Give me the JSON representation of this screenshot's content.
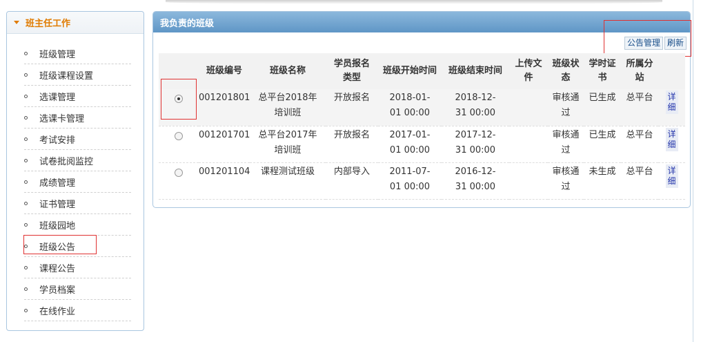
{
  "sidebar": {
    "title": "班主任工作",
    "items": [
      {
        "label": "班级管理"
      },
      {
        "label": "班级课程设置"
      },
      {
        "label": "选课管理"
      },
      {
        "label": "选课卡管理"
      },
      {
        "label": "考试安排"
      },
      {
        "label": "试卷批阅监控"
      },
      {
        "label": "成绩管理"
      },
      {
        "label": "证书管理"
      },
      {
        "label": "班级园地"
      },
      {
        "label": "班级公告"
      },
      {
        "label": "课程公告"
      },
      {
        "label": "学员档案"
      },
      {
        "label": "在线作业"
      }
    ]
  },
  "panel": {
    "title": "我负责的班级",
    "toolbar": {
      "announce_label": "公告管理",
      "refresh_label": "刷新"
    },
    "columns": [
      "班级编号",
      "班级名称",
      "学员报名类型",
      "班级开始时间",
      "班级结束时间",
      "上传文件",
      "班级状态",
      "学时证书",
      "所属分站"
    ],
    "rows": [
      {
        "selected": true,
        "code": "001201801",
        "name": "总平台2018年培训班",
        "type": "开放报名",
        "start": "2018-01-01 00:00",
        "end": "2018-12-31 00:00",
        "file": "",
        "status": "审核通过",
        "cert": "已生成",
        "station": "总平台",
        "detail": "详细"
      },
      {
        "selected": false,
        "code": "001201701",
        "name": "总平台2017年培训班",
        "type": "开放报名",
        "start": "2017-01-01 00:00",
        "end": "2017-12-31 00:00",
        "file": "",
        "status": "审核通过",
        "cert": "已生成",
        "station": "总平台",
        "detail": "详细"
      },
      {
        "selected": false,
        "code": "001201104",
        "name": "课程测试班级",
        "type": "内部导入",
        "start": "2011-07-01 00:00",
        "end": "2016-12-31 00:00",
        "file": "",
        "status": "审核通过",
        "cert": "未生成",
        "station": "总平台",
        "detail": "详细"
      }
    ]
  },
  "colors": {
    "accent": "#e07b00",
    "header_blue": "#6a9fcc",
    "highlight": "#e03030"
  }
}
